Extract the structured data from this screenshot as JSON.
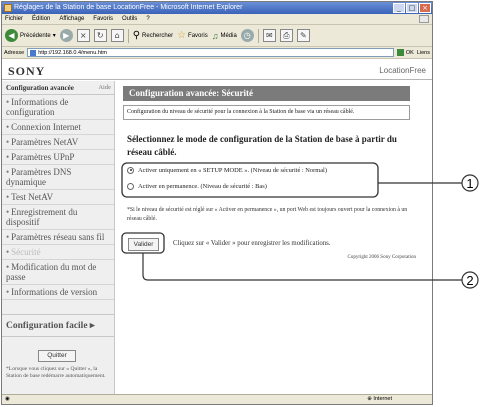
{
  "window": {
    "title": "Réglages de la Station de base LocationFree - Microsoft Internet Explorer",
    "controls": [
      "_",
      "□",
      "×"
    ]
  },
  "menubar": [
    "Fichier",
    "Édition",
    "Affichage",
    "Favoris",
    "Outils",
    "?"
  ],
  "toolbar": {
    "back_label": "Précédente",
    "search_label": "Rechercher",
    "favorites_label": "Favoris",
    "media_label": "Média"
  },
  "address": {
    "label": "Adresse",
    "url": "http://192.168.0.4/menu.htm",
    "go_label": "OK",
    "links_label": "Liens"
  },
  "header": {
    "brand": "SONY",
    "product": "LocationFree"
  },
  "sidebar": {
    "title": "Configuration avancée",
    "help": "Aide",
    "items": [
      {
        "label": "Informations de configuration",
        "active": false
      },
      {
        "label": "Connexion Internet",
        "active": false
      },
      {
        "label": "Paramètres NetAV",
        "active": false
      },
      {
        "label": "Paramètres UPnP",
        "active": false
      },
      {
        "label": "Paramètres DNS dynamique",
        "active": false
      },
      {
        "label": "Test NetAV",
        "active": false
      },
      {
        "label": "Enregistrement du dispositif",
        "active": false
      },
      {
        "label": "Paramètres réseau sans fil",
        "active": false
      },
      {
        "label": "Sécurité",
        "active": true
      },
      {
        "label": "Modification du mot de passe",
        "active": false
      },
      {
        "label": "Informations de version",
        "active": false
      }
    ],
    "quick_setup": "Configuration facile",
    "quit_label": "Quitter",
    "quit_note": "*Lorsque vous cliquez sur « Quitter », la Station de base redémarre automatiquement."
  },
  "main": {
    "heading": "Configuration avancée: Sécurité",
    "description": "Configuration du niveau de sécurité pour la connexion à la Station de base via un réseau câblé.",
    "question": "Sélectionnez le mode de configuration de la Station de base à partir du réseau câblé.",
    "options": [
      {
        "label": "Activer uniquement en « SETUP MODE ». (Niveau de sécurité : Normal)",
        "selected": true
      },
      {
        "label": "Activer en permanence. (Niveau de sécurité : Bas)",
        "selected": false
      }
    ],
    "note": "*Si le niveau de sécurité est réglé sur « Activer en permanence », un port Web est toujours ouvert pour la connexion à un réseau câblé.",
    "validate_label": "Valider",
    "validate_text": "Cliquez sur « Valider » pour enregistrer les modifications.",
    "copyright": "Copyright 2006 Sony Corporation"
  },
  "statusbar": {
    "zone": "Internet"
  },
  "callouts": [
    "1",
    "2"
  ]
}
